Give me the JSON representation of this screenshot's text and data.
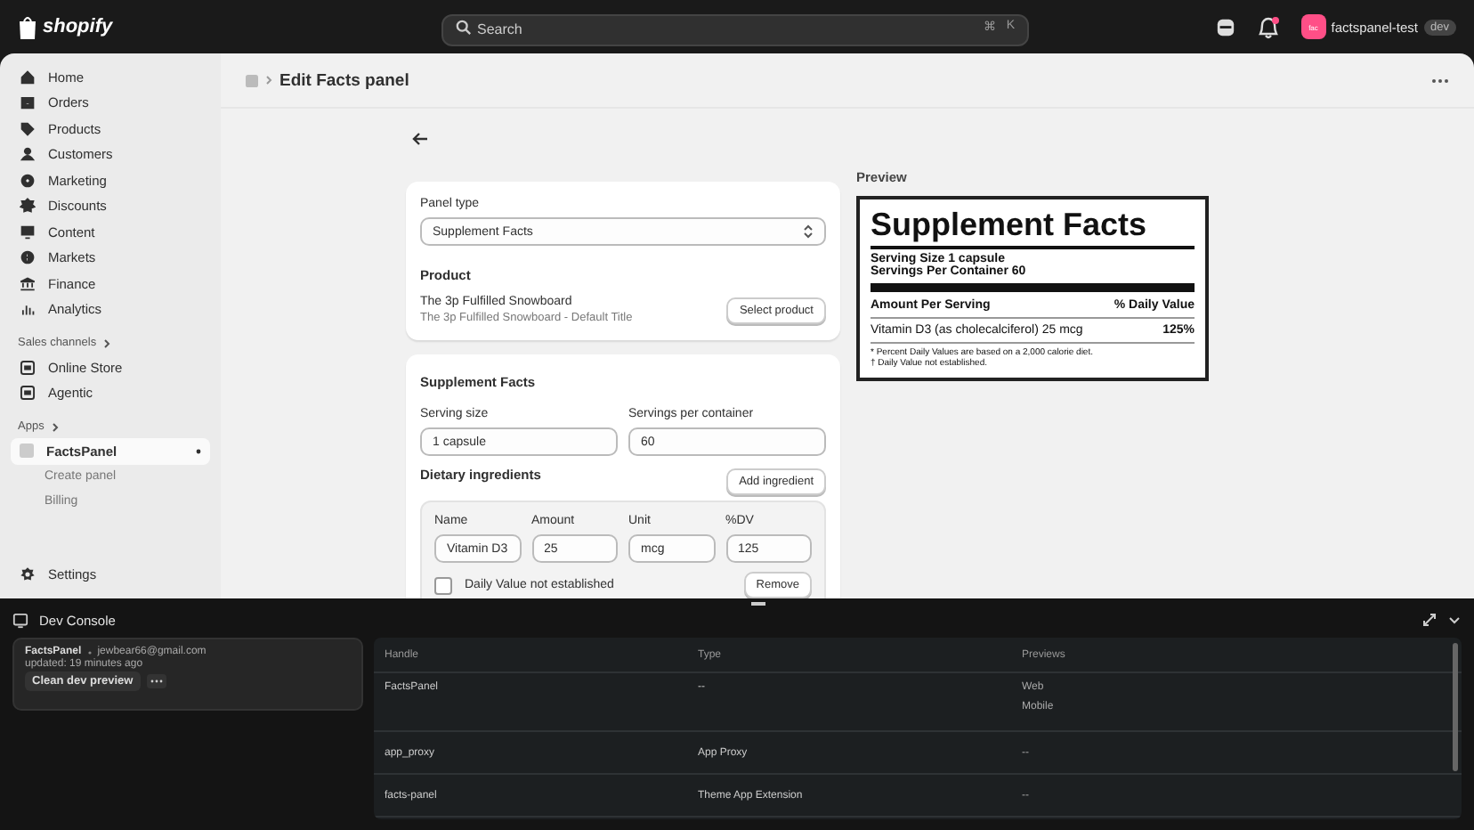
{
  "topbar": {
    "logo": "shopify",
    "search": {
      "placeholder": "Search"
    },
    "shortcut": [
      "⌘",
      "K"
    ],
    "store": {
      "initials": "fac",
      "name": "factspanel-test",
      "badge": "dev"
    }
  },
  "sidebar": {
    "items": [
      {
        "label": "Home",
        "selected": false
      },
      {
        "label": "Orders",
        "selected": false
      },
      {
        "label": "Products",
        "selected": false
      },
      {
        "label": "Customers",
        "selected": false
      },
      {
        "label": "Marketing",
        "selected": false
      },
      {
        "label": "Discounts",
        "selected": false
      },
      {
        "label": "Content",
        "selected": false
      },
      {
        "label": "Markets",
        "selected": false
      },
      {
        "label": "Finance",
        "selected": false
      },
      {
        "label": "Analytics",
        "selected": false
      }
    ],
    "sales_channels": {
      "heading": "Sales channels",
      "items": [
        {
          "label": "Online Store",
          "selected": false
        },
        {
          "label": "Agentic",
          "selected": false
        }
      ]
    },
    "apps": {
      "heading": "Apps",
      "items": [
        {
          "label": "FactsPanel",
          "selected": true,
          "children": [
            {
              "label": "Create panel",
              "selected": false
            },
            {
              "label": "Billing",
              "selected": false
            }
          ]
        }
      ]
    },
    "settings": "Settings"
  },
  "page": {
    "title": "Edit Facts panel",
    "panel_type": {
      "label": "Panel type",
      "value": "Supplement Facts"
    },
    "product": {
      "heading": "Product",
      "name": "The 3p Fulfilled Snowboard",
      "variant": "The 3p Fulfilled Snowboard - Default Title",
      "button": "Select product"
    },
    "facts": {
      "heading": "Supplement Facts",
      "serving_size": {
        "label": "Serving size",
        "value": "1 capsule"
      },
      "servings": {
        "label": "Servings per container",
        "value": "60"
      },
      "ingredients_heading": "Dietary ingredients",
      "add_button": "Add ingredient",
      "ingredients": [
        {
          "fields": [
            {
              "label": "Name",
              "value": "Vitamin D3"
            },
            {
              "label": "Amount",
              "value": "25"
            },
            {
              "label": "Unit",
              "value": "mcg"
            },
            {
              "label": "%DV",
              "value": "125"
            }
          ],
          "checkbox": {
            "label": "Daily Value not established",
            "checked": false
          },
          "remove": "Remove"
        }
      ]
    },
    "preview": {
      "heading": "Preview",
      "title": "Supplement Facts",
      "serving_size": "Serving Size **1** capsule",
      "servings": "Servings Per Container 60",
      "col_amount": "Amount Per Serving",
      "col_dv": "% Daily Value",
      "rows": [
        {
          "name": "Vitamin D3 (as cholecalciferol) 25 mcg",
          "dv": "125%"
        }
      ],
      "footnotes": [
        "* Percent Daily Values are based on a 2,000 calorie diet.",
        "† Daily Value not established."
      ]
    }
  },
  "dev_console": {
    "title": "Dev Console",
    "app": {
      "name": "FactsPanel",
      "email": "jewbear66@gmail.com",
      "updated": "updated: 19 minutes ago",
      "button": "Clean dev preview"
    },
    "columns": [
      "Handle",
      "Type",
      "Previews"
    ],
    "rows": [
      {
        "handle": "FactsPanel",
        "type": "--",
        "previews": [
          "Web",
          "Mobile"
        ]
      },
      {
        "handle": "app_proxy",
        "type": "App Proxy",
        "previews": [
          "--"
        ]
      },
      {
        "handle": "facts-panel",
        "type": "Theme App Extension",
        "previews": [
          "--"
        ]
      }
    ]
  }
}
